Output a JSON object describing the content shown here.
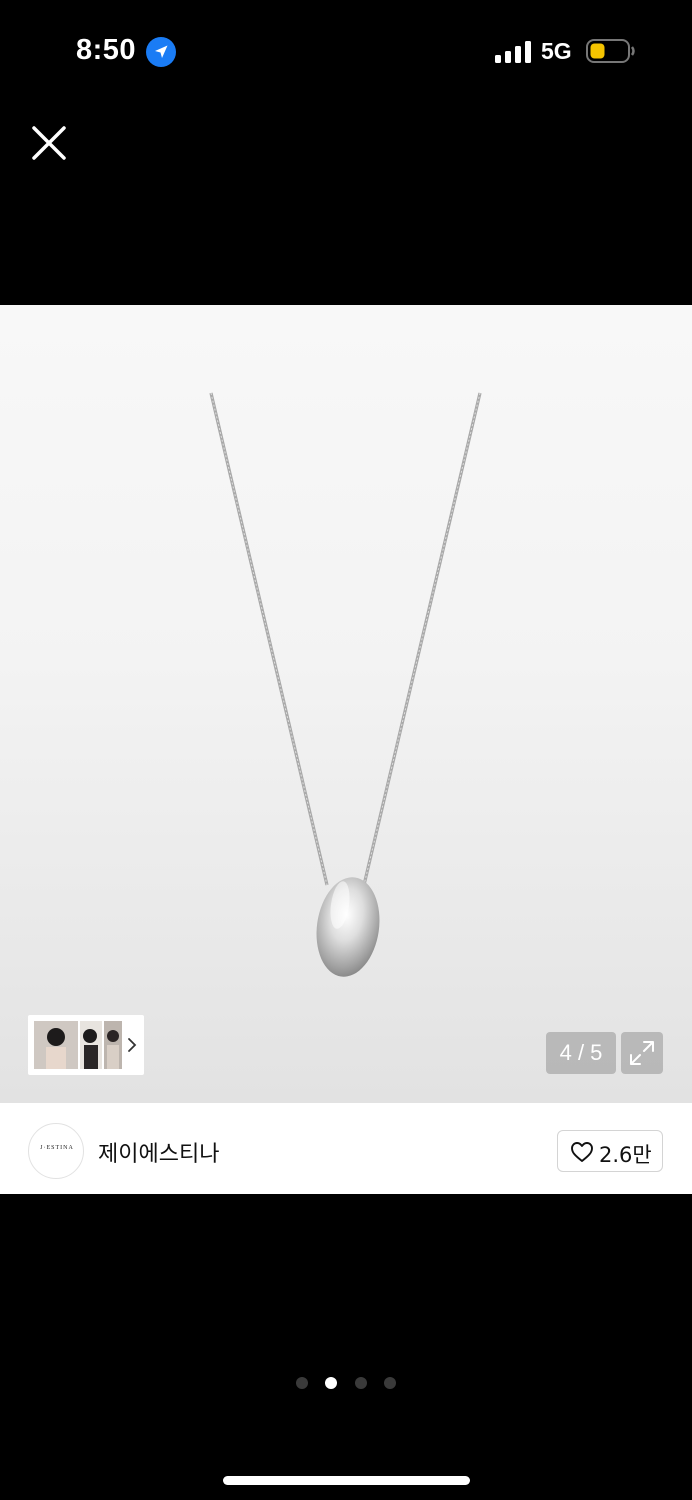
{
  "status_bar": {
    "time": "8:50",
    "network": "5G",
    "location_icon": "location-arrow-icon",
    "signal_icon": "signal-bars-icon",
    "battery_icon": "battery-low-icon",
    "battery_color": "#f5c400"
  },
  "toolbar": {
    "close_icon": "close-icon"
  },
  "gallery": {
    "counter": "4 / 5",
    "expand_icon": "expand-icon",
    "thumbnail_arrow_icon": "chevron-right-icon"
  },
  "brand": {
    "logo_text": "J·ESTINA",
    "name": "제이에스티나"
  },
  "like": {
    "icon": "heart-outline-icon",
    "count": "2.6만"
  },
  "pager": {
    "count": 4,
    "active_index": 1
  }
}
